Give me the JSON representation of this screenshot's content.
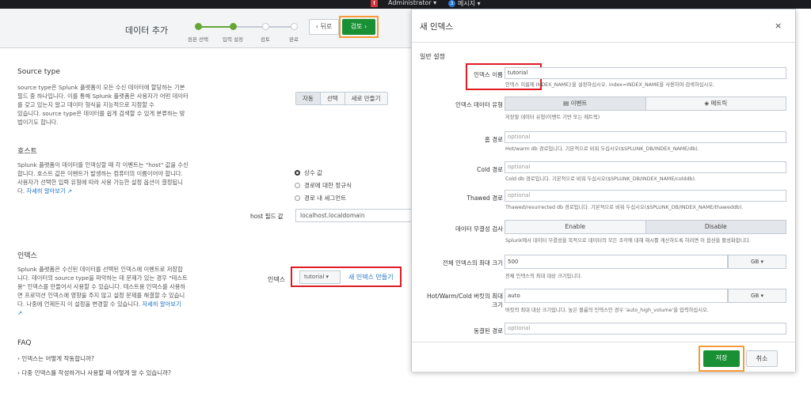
{
  "topbar": {
    "warn": "!",
    "user": "Administrator ▾",
    "badge": "3",
    "messages": "메시지 ▾"
  },
  "wizard": {
    "title": "데이터 추가",
    "steps": [
      "원본 선택",
      "입력 설정",
      "검토",
      "완료"
    ],
    "back": "‹ 뒤로",
    "next": "검토 ›"
  },
  "source_type": {
    "title": "Source type",
    "desc": [
      "source type은 Splunk 플랫폼이 모든 수신 데이터에 할당하는 기본",
      "필드 중 하나입니다. 이를 통해 Splunk 플랫폼은 사용자가 어떤 데이터",
      "를 갖고 있는지 알고 데이터 형식을 지능적으로 지정할 수",
      "있습니다. source type은 데이터를 쉽게 검색할 수 있게 분류하는 방",
      "법이기도 합니다."
    ],
    "buttons": [
      "자동",
      "선택",
      "새로 만들기"
    ]
  },
  "host": {
    "title": "호스트",
    "desc": [
      "Splunk 플랫폼이 데이터를 인덱싱할 때 각 이벤트는 \"host\" 값을 수신",
      "합니다. 호스트 값은 이벤트가 발생하는 컴퓨터의 이름이어야 합니다.",
      "사용자가 선택한 입력 유형에 따라 사용 가능한 설정 옵션이 결정됩니",
      "다."
    ],
    "learn_more": "자세히 알아보기 ↗",
    "options": [
      "상수 값",
      "경로에 대한 정규식",
      "경로 내 세그먼트"
    ],
    "field_label": "host 필드 값",
    "field_value": "localhost.localdomain"
  },
  "index": {
    "title": "인덱스",
    "desc": [
      "Splunk 플랫폼은 수신된 데이터를 선택된 인덱스에 이벤트로 저장합",
      "니다. 데이터의 source type을 파악하는 데 문제가 있는 경우 \"테스트",
      "용\" 인덱스를 만들어서 사용할 수 있습니다. 테스트용 인덱스를 사용하",
      "면 프로덕션 인덱스에 영향을 주지 않고 설정 문제를 해결할 수 있습니",
      "다. 나중에 언제든지 이 설정을 변경할 수 있습니다."
    ],
    "learn_more": "자세히 알아보기",
    "label": "인덱스",
    "selected": "tutorial ▾",
    "create": "새 인덱스 만들기"
  },
  "faq": {
    "title": "FAQ",
    "items": [
      "› 인덱스는 어떻게 작동합니까?",
      "› 다중 인덱스를 작성하거나 사용할 때 어떻게 알 수 있습니까?"
    ]
  },
  "modal": {
    "title": "새 인덱스",
    "close": "×",
    "section": "일반 설정",
    "name_label": "인덱스 이름",
    "name_value": "tutorial",
    "name_help": "인덱스 이름에 INDEX_NAME}을 설정하십시오. index=INDEX_NAME을 사용하여 검색하십시오.",
    "type_label": "인덱스 데이터 유형",
    "type_options": [
      "▤ 이벤트",
      "◈ 메트릭"
    ],
    "type_help": "저장할 데이터 유형(이벤트 기반 또는 메트릭)",
    "home_label": "홈 경로",
    "home_placeholder": "optional",
    "home_help": "Hot/warm db 경로입니다. 기본적으로 비워 두십시오($SPLUNK_DB/INDEX_NAME/db).",
    "cold_label": "Cold 경로",
    "cold_placeholder": "optional",
    "cold_help": "Cold db 경로입니다. 기본적으로 비워 두십시오($SPLUNK_DB/INDEX_NAME/colddb).",
    "thawed_label": "Thawed 경로",
    "thawed_placeholder": "optional",
    "thawed_help": "Thawed/resurrected db 경로입니다. 기본적으로 비워 두십시오($SPLUNK_DB/INDEX_NAME/thaweddb).",
    "integrity_label": "데이터 무결성 검사",
    "integrity_options": [
      "Enable",
      "Disable"
    ],
    "integrity_help": "Splunk에서 데이터 무결성을 목적으로 데이터의 모든 조각에 대해 해시를 계산하도록 하려면 이 옵션을 활성화합니다.",
    "maxsize_label": "전체 인덱스의 최대 크기",
    "maxsize_value": "500",
    "maxsize_unit": "GB ▾",
    "maxsize_help": "전체 인덱스의 최대 대상 크기입니다.",
    "bucket_label1": "Hot/Warm/Cold 버킷의 최대",
    "bucket_label2": "크기",
    "bucket_value": "auto",
    "bucket_unit": "GB ▾",
    "bucket_help": "버킷의 최대 대상 크기입니다. 높은 볼륨의 인덱스인 경우 'auto_high_volume'을 입력하십시오.",
    "frozen_label": "동결된 경로",
    "frozen_placeholder": "optional",
    "save": "저장",
    "cancel": "취소"
  }
}
